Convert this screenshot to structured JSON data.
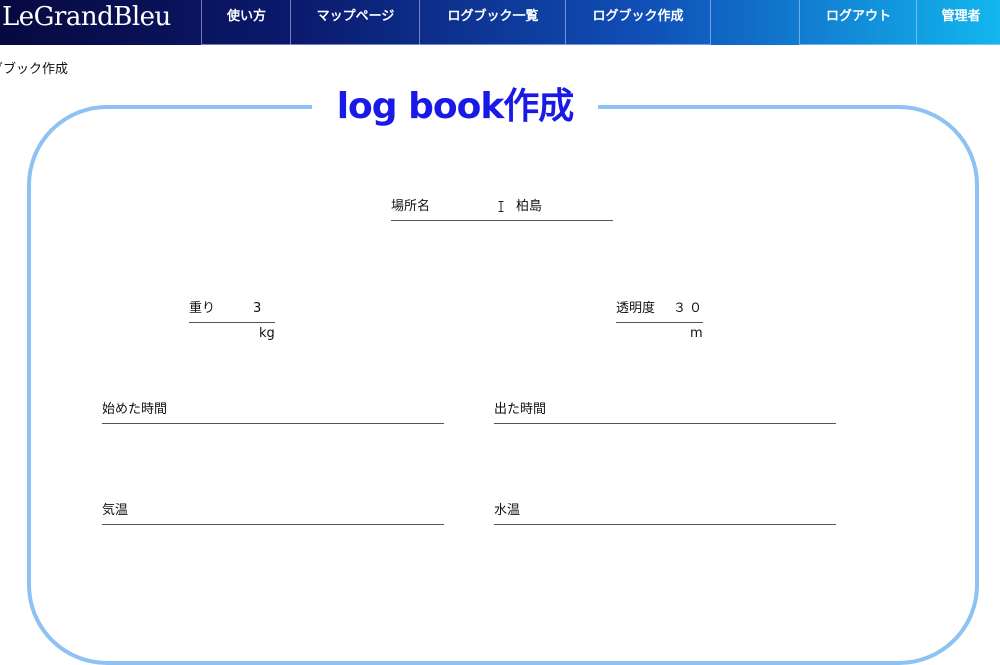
{
  "nav": {
    "brand": "LeGrandBleu",
    "guide": "使い方",
    "map": "マップページ",
    "logbook_list": "ログブック一覧",
    "logbook_create": "ログブック作成",
    "logout": "ログアウト",
    "admin": "管理者"
  },
  "breadcrumb": "グブック作成",
  "form": {
    "title": "log book作成",
    "place": {
      "label": "場所名",
      "value": "柏島"
    },
    "weight": {
      "label": "重り",
      "value": "3",
      "unit": "kg"
    },
    "clarity": {
      "label": "透明度",
      "value": "３０",
      "unit": "m"
    },
    "start_time": {
      "label": "始めた時間",
      "value": ""
    },
    "end_time": {
      "label": "出た時間",
      "value": ""
    },
    "air_temp": {
      "label": "気温",
      "value": ""
    },
    "water_temp": {
      "label": "水温",
      "value": ""
    }
  },
  "colors": {
    "frame": "#8ec2f3",
    "title": "#1a1ae6",
    "nav_start": "#07093f",
    "nav_end": "#13b6ee"
  },
  "icons": {
    "text_cursor": "i-beam-cursor-icon"
  }
}
